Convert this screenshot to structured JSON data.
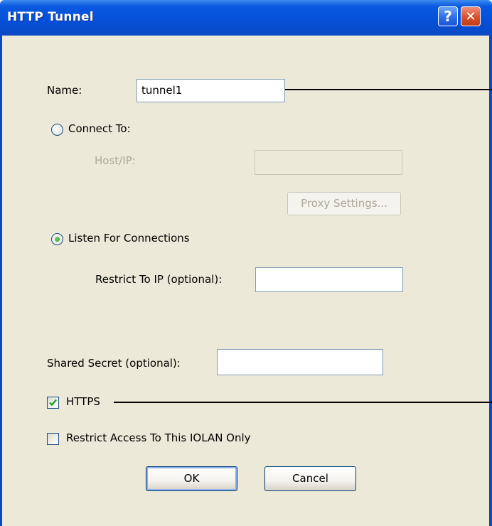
{
  "window": {
    "title": "HTTP Tunnel",
    "help_glyph": "?",
    "close_glyph": "✕"
  },
  "form": {
    "name_label": "Name:",
    "name_value": "tunnel1",
    "connect_to_label": "Connect To:",
    "host_ip_label": "Host/IP:",
    "host_ip_value": "",
    "proxy_settings_label": "Proxy Settings...",
    "listen_label": "Listen For Connections",
    "restrict_ip_label": "Restrict To IP (optional):",
    "restrict_ip_value": "",
    "shared_secret_label": "Shared Secret (optional):",
    "shared_secret_value": "",
    "https_label": "HTTPS",
    "restrict_access_label": "Restrict Access To This IOLAN Only",
    "connect_to_selected": false,
    "listen_selected": true,
    "https_checked": true,
    "restrict_access_checked": false
  },
  "buttons": {
    "ok_label": "OK",
    "cancel_label": "Cancel"
  },
  "colors": {
    "titlebar": "#0a58e0",
    "dialog_bg": "#ece9d8",
    "check_mark": "#21a121"
  }
}
